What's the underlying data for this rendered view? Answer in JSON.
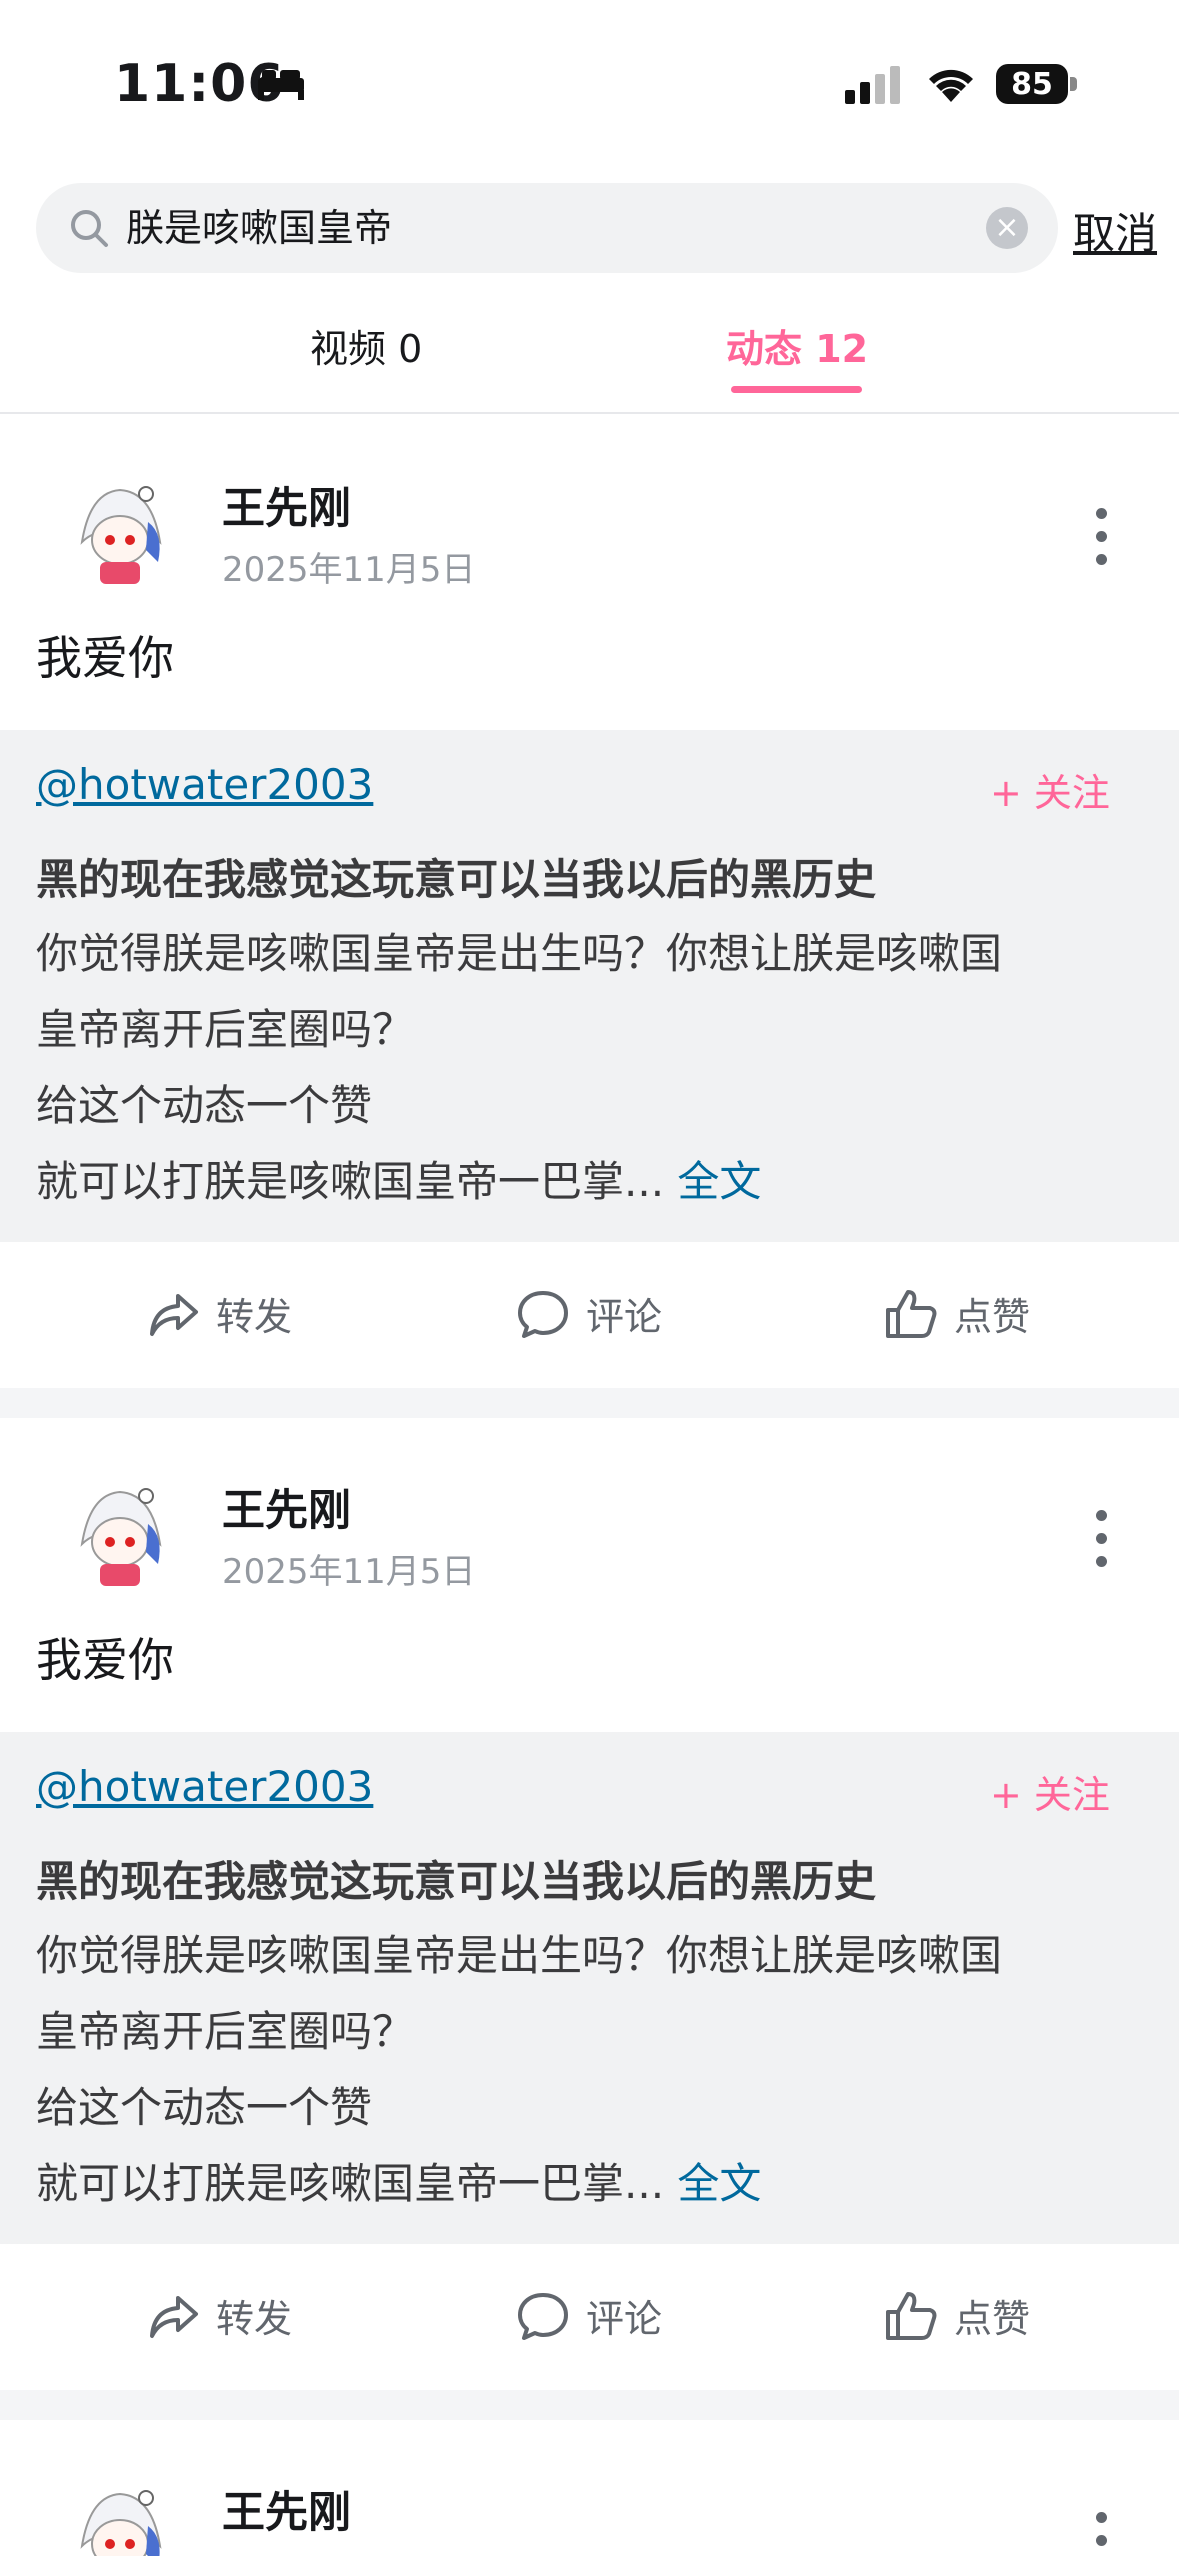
{
  "status_bar": {
    "time": "11:06",
    "battery": "85"
  },
  "search": {
    "query": "朕是咳嗽国皇帝",
    "cancel_label": "取消"
  },
  "tabs": [
    {
      "label": "视频 0"
    },
    {
      "label": "动态 12"
    }
  ],
  "posts": [
    {
      "username": "王先刚",
      "date": "2025年11月5日",
      "text": "我爱你",
      "quote": {
        "user": "@hotwater2003",
        "follow_label": "+ 关注",
        "title": "黑的现在我感觉这玩意可以当我以后的黑历史",
        "line1": "你觉得朕是咳嗽国皇帝是出生吗？你想让朕是咳嗽国",
        "line2": "皇帝离开后室圈吗？",
        "line3": "给这个动态一个赞",
        "line4": "就可以打朕是咳嗽国皇帝一巴掌...",
        "fulltext_label": "全文"
      },
      "actions": {
        "repost": "转发",
        "comment": "评论",
        "like": "点赞"
      }
    },
    {
      "username": "王先刚",
      "date": "2025年11月5日",
      "text": "我爱你",
      "quote": {
        "user": "@hotwater2003",
        "follow_label": "+ 关注",
        "title": "黑的现在我感觉这玩意可以当我以后的黑历史",
        "line1": "你觉得朕是咳嗽国皇帝是出生吗？你想让朕是咳嗽国",
        "line2": "皇帝离开后室圈吗？",
        "line3": "给这个动态一个赞",
        "line4": "就可以打朕是咳嗽国皇帝一巴掌...",
        "fulltext_label": "全文"
      },
      "actions": {
        "repost": "转发",
        "comment": "评论",
        "like": "点赞"
      }
    },
    {
      "username": "王先刚"
    }
  ],
  "colors": {
    "accent": "#ff6699",
    "link": "#00699d"
  }
}
